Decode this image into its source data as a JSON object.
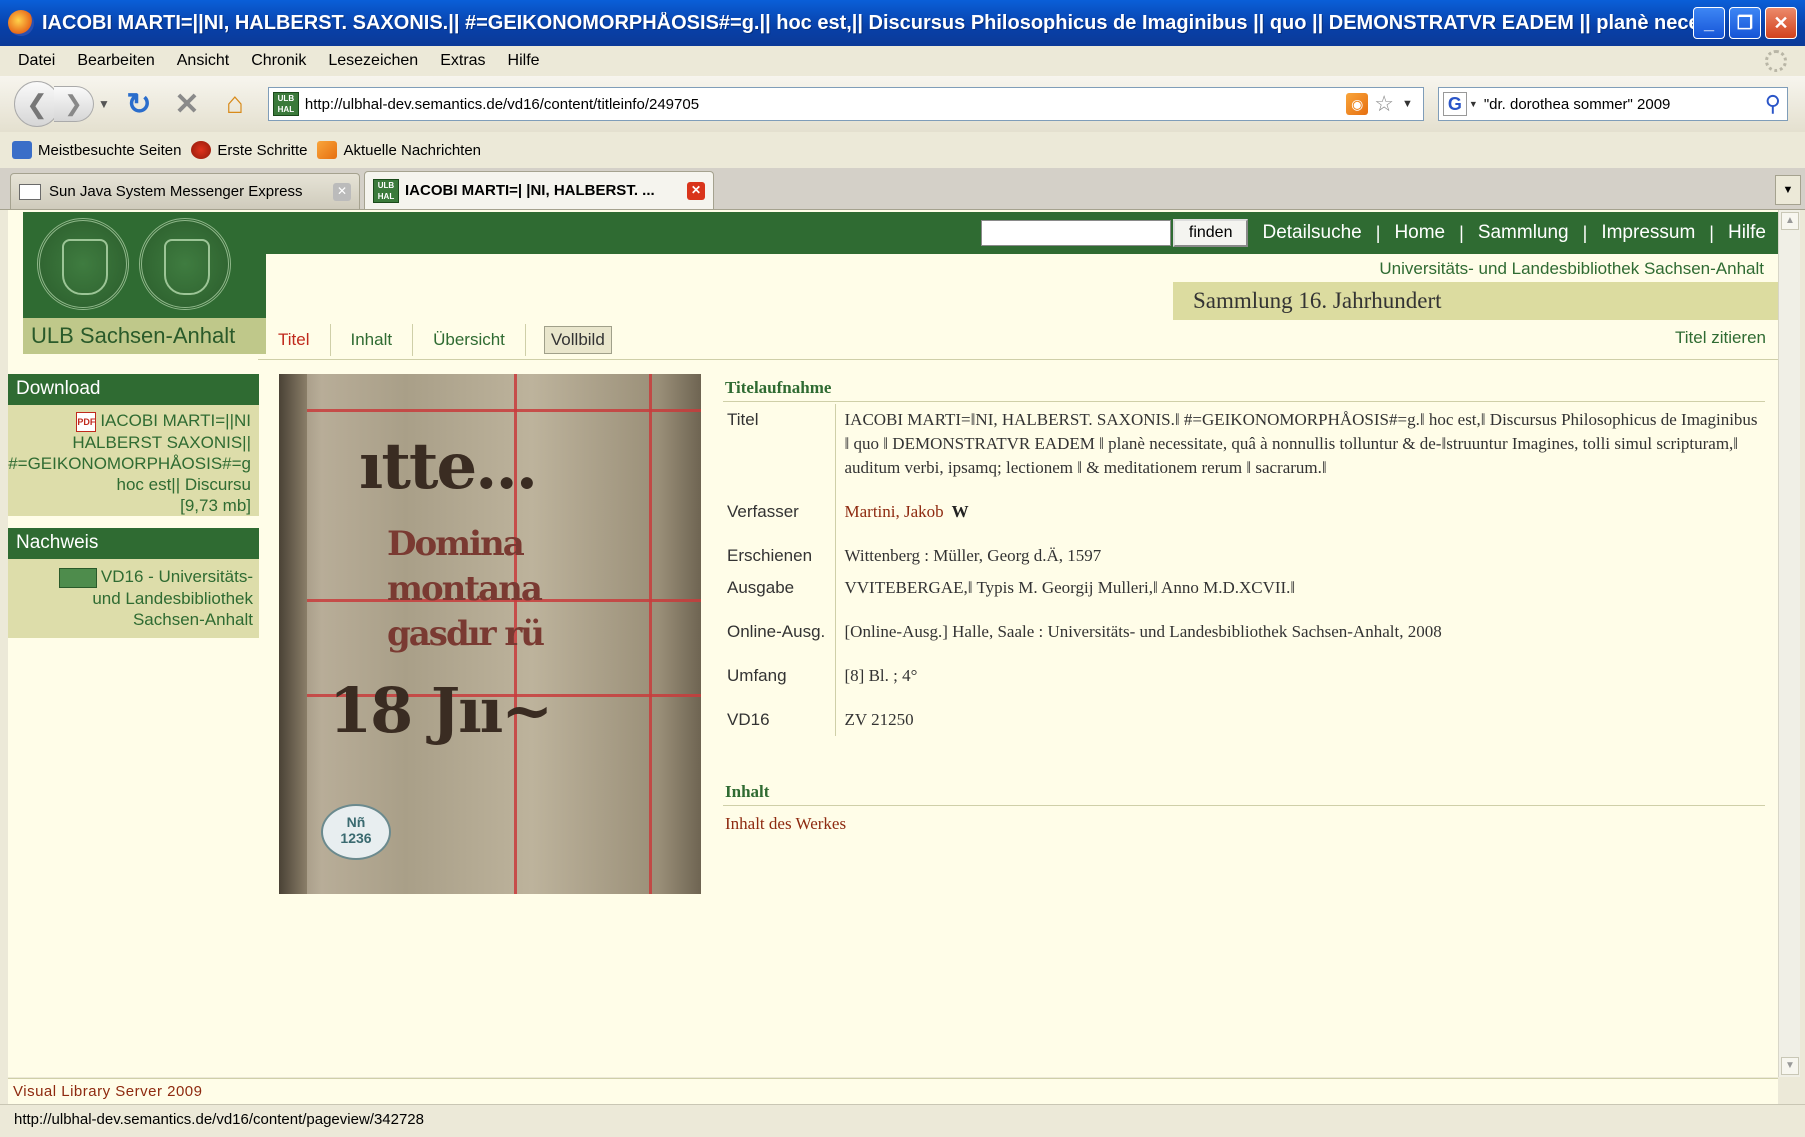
{
  "window": {
    "title": "IACOBI MARTI=||NI, HALBERST. SAXONIS.|| #=GEIKONOMORPHÅOSIS#=g.|| hoc est,|| Discursus Philosophicus de Imaginibus || quo || DEMONSTRATVR EADEM || planè necessitate, quâ à..."
  },
  "menu": [
    "Datei",
    "Bearbeiten",
    "Ansicht",
    "Chronik",
    "Lesezeichen",
    "Extras",
    "Hilfe"
  ],
  "toolbar": {
    "url": "http://ulbhal-dev.semantics.de/vd16/content/titleinfo/249705",
    "search": "\"dr. dorothea sommer\" 2009"
  },
  "bookmarks": [
    "Meistbesuchte Seiten",
    "Erste Schritte",
    "Aktuelle Nachrichten"
  ],
  "tabs": [
    {
      "label": "Sun Java System Messenger Express"
    },
    {
      "label": "IACOBI MARTI=| |NI, HALBERST. ..."
    }
  ],
  "site": {
    "logo_label": "ULB Sachsen-Anhalt",
    "search_button": "finden",
    "topnav": [
      "Detailsuche",
      "Home",
      "Sammlung",
      "Impressum",
      "Hilfe"
    ],
    "library_name": "Universitäts- und Landesbibliothek Sachsen-Anhalt",
    "collection": "Sammlung 16. Jahrhundert",
    "subnav": [
      "Titel",
      "Inhalt",
      "Übersicht"
    ],
    "fullview": "Vollbild",
    "cite": "Titel zitieren"
  },
  "sidebar": {
    "download_head": "Download",
    "download_lines": [
      "IACOBI MARTI=||NI",
      "HALBERST SAXONIS||",
      "#=GEIKONOMORPHÅOSIS#=g",
      "hoc est|| Discursu",
      "[9,73 mb]"
    ],
    "nachweis_head": "Nachweis",
    "nachweis_lines": [
      "VD16 - Universitäts-",
      "und Landesbibliothek",
      "Sachsen-Anhalt"
    ]
  },
  "cover": {
    "lines": [
      "ıtte...",
      "Domina",
      "montana",
      "gasdır rü",
      "18 Jıı~"
    ],
    "label": [
      "Nñ",
      "1236"
    ]
  },
  "record": {
    "section_title": "Titelaufnahme",
    "fields": [
      {
        "label": "Titel",
        "value": "IACOBI MARTI=‖NI, HALBERST. SAXONIS.‖ #=GEIKONOMORPHÅOSIS#=g.‖ hoc est,‖ Discursus Philosophicus de Imaginibus ‖ quo ‖ DEMONSTRATVR EADEM ‖ planè necessitate, quâ à nonnullis tolluntur & de-‖struuntur Imagines, tolli simul scripturam,‖ auditum verbi, ipsamq; lectionem ‖ & meditationem rerum ‖ sacrarum.‖"
      },
      {
        "label": "Verfasser",
        "value": "Martini, Jakob",
        "icon": "W"
      },
      {
        "label": "Erschienen",
        "value": "Wittenberg : Müller, Georg d.Ä, 1597"
      },
      {
        "label": "Ausgabe",
        "value": "VVITEBERGAE,‖ Typis M. Georgij Mulleri,‖ Anno M.D.XCVII.‖"
      },
      {
        "label": "Online-Ausg.",
        "value": "[Online-Ausg.] Halle, Saale : Universitäts- und Landesbibliothek Sachsen-Anhalt, 2008"
      },
      {
        "label": "Umfang",
        "value": "[8] Bl. ; 4°"
      },
      {
        "label": "VD16",
        "value": "ZV 21250"
      }
    ],
    "content_title": "Inhalt",
    "content_link": "Inhalt des Werkes"
  },
  "footer": "Visual Library Server 2009",
  "status": "http://ulbhal-dev.semantics.de/vd16/content/pageview/342728"
}
